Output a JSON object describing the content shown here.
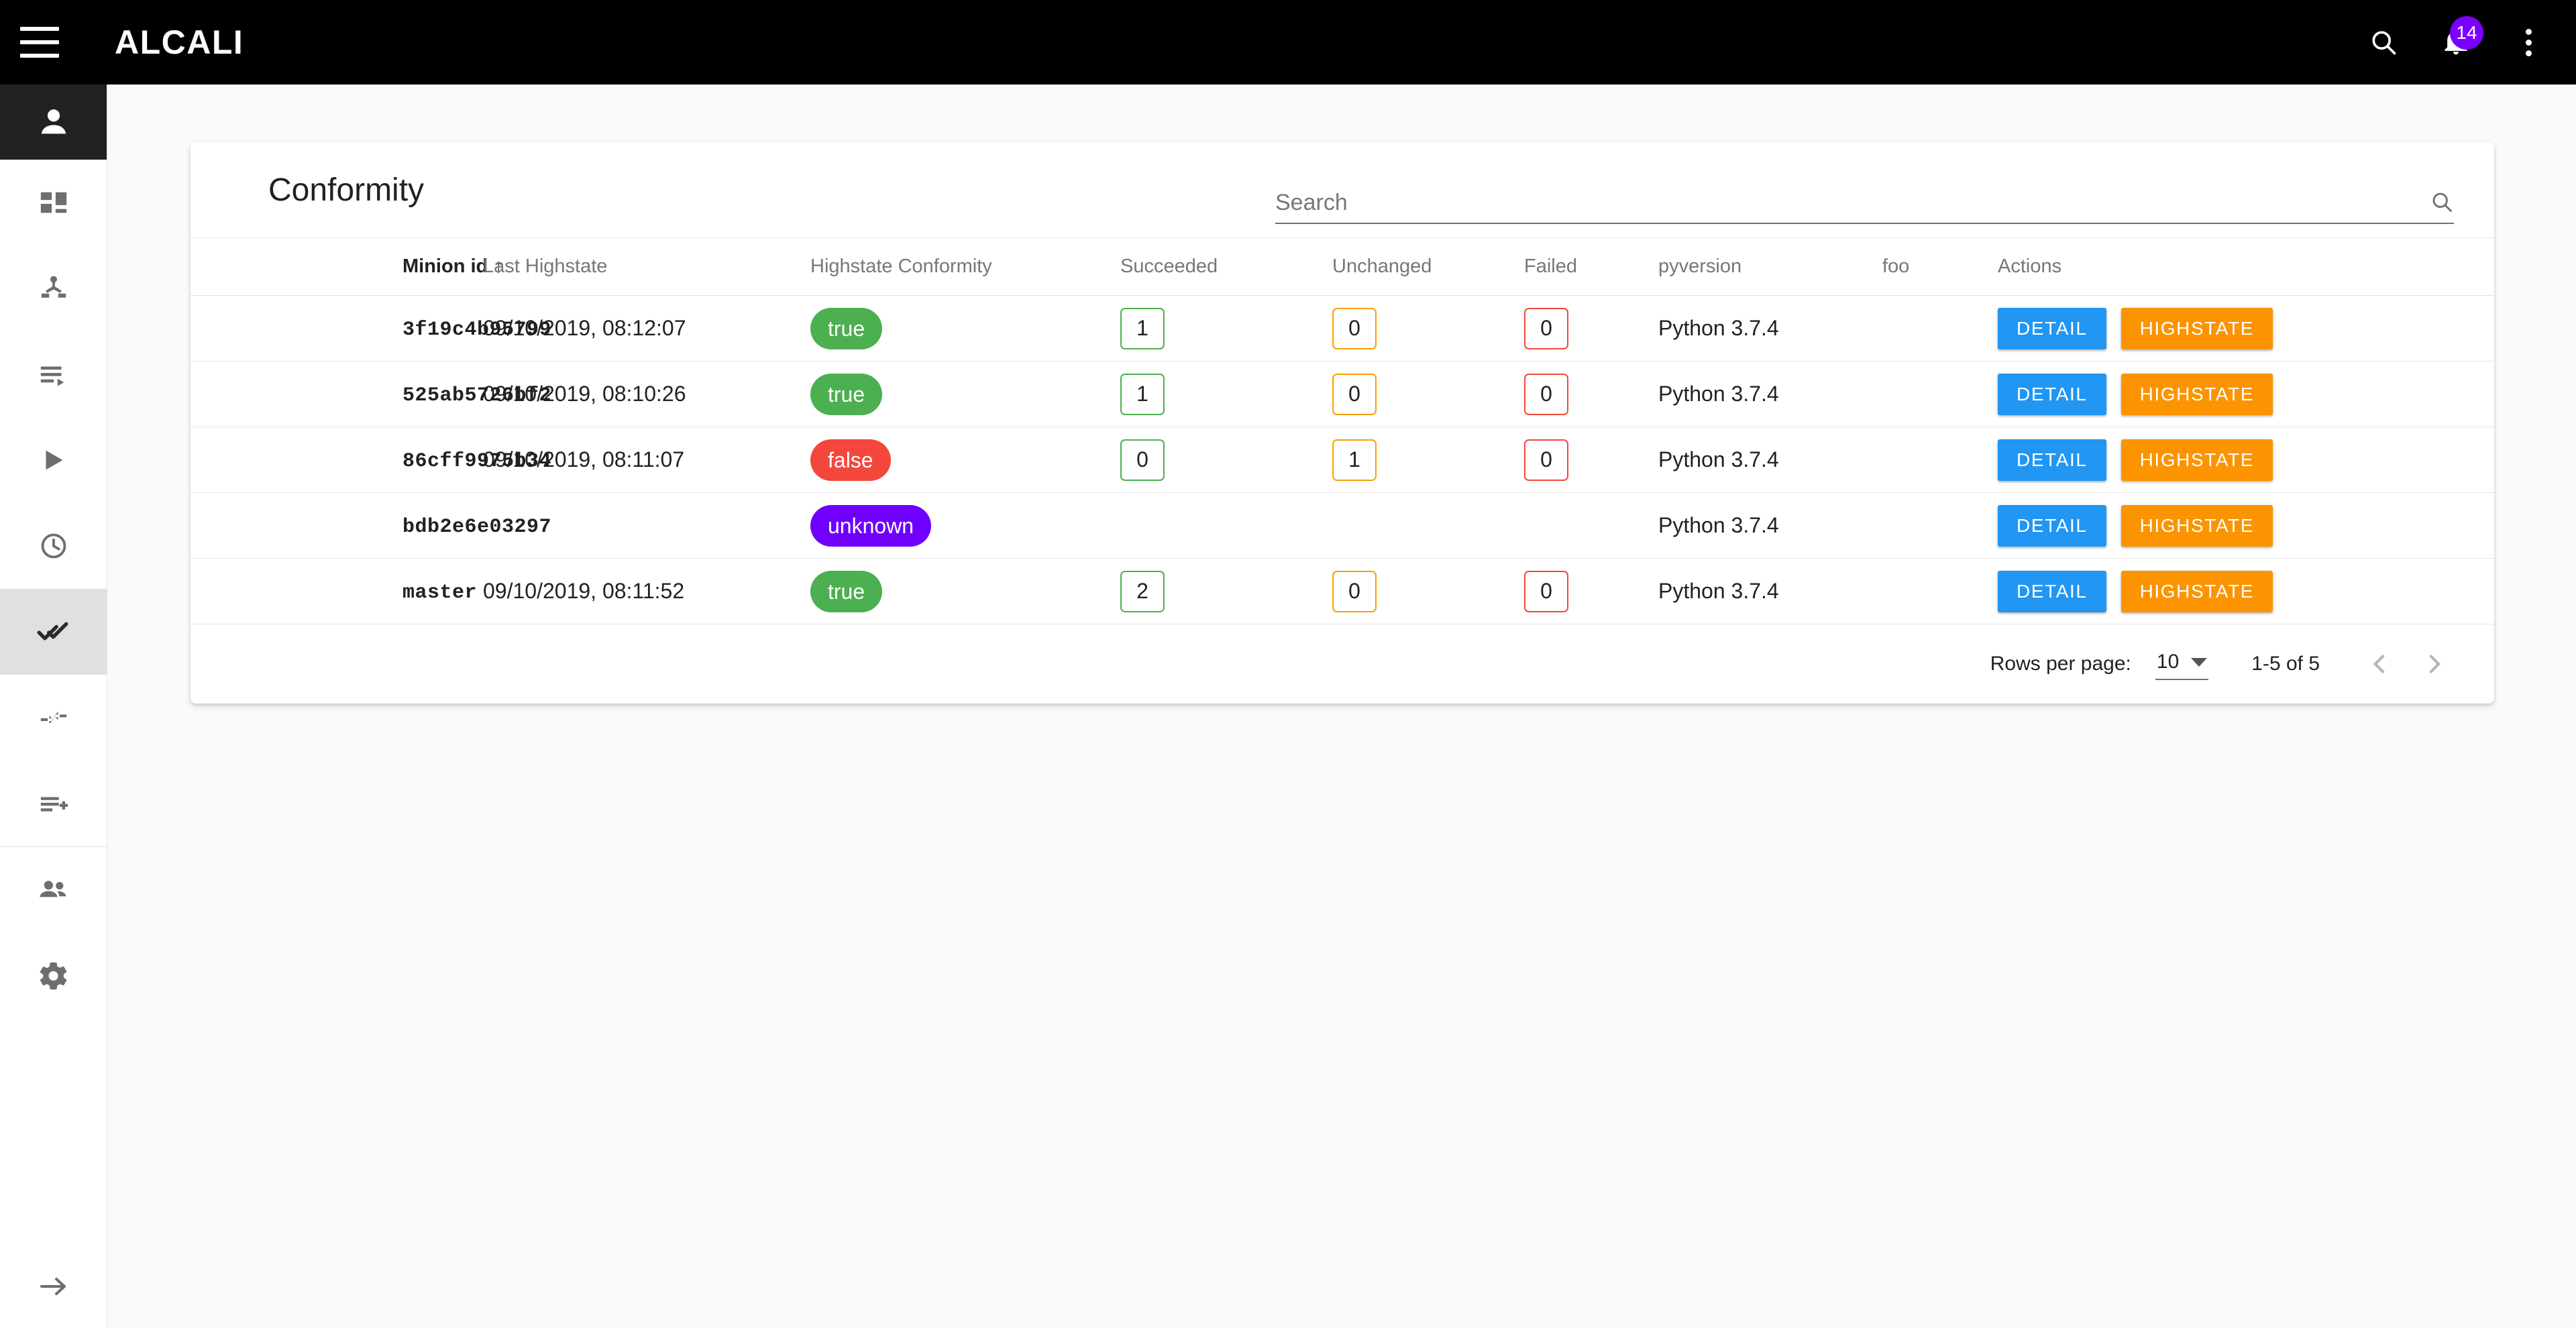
{
  "appbar": {
    "menu_icon": "hamburger-menu-icon",
    "title": "ALCALI",
    "search_icon": "search-icon",
    "notifications_icon": "bell-icon",
    "notifications_count": "14",
    "overflow_icon": "more-vertical-icon"
  },
  "sidebar": {
    "avatar_icon": "person-icon",
    "items": [
      {
        "name": "dashboard",
        "icon": "dashboard-grid-icon",
        "active": false
      },
      {
        "name": "minions",
        "icon": "hierarchy-network-icon",
        "active": false
      },
      {
        "name": "jobs",
        "icon": "queue-list-icon",
        "active": false
      },
      {
        "name": "run",
        "icon": "play-arrow-icon",
        "active": false
      },
      {
        "name": "schedule",
        "icon": "clock-history-icon",
        "active": false
      },
      {
        "name": "conformity",
        "icon": "double-check-icon",
        "active": true
      },
      {
        "name": "sync",
        "icon": "compare-arrows-icon",
        "active": false
      },
      {
        "name": "add-job",
        "icon": "playlist-add-icon",
        "active": false
      },
      {
        "name": "users",
        "icon": "people-group-icon",
        "active": false
      },
      {
        "name": "settings",
        "icon": "gear-icon",
        "active": false
      }
    ],
    "collapse_icon": "arrow-forward-icon"
  },
  "page": {
    "title": "Conformity"
  },
  "search": {
    "placeholder": "Search",
    "value": "",
    "icon": "search-icon"
  },
  "table": {
    "columns": [
      {
        "label": "Minion id",
        "sorted": true,
        "sort_arrow": "↑"
      },
      {
        "label": "Last Highstate",
        "sorted": false,
        "sort_arrow": ""
      },
      {
        "label": "Highstate Conformity",
        "sorted": false,
        "sort_arrow": ""
      },
      {
        "label": "Succeeded",
        "sorted": false,
        "sort_arrow": ""
      },
      {
        "label": "Unchanged",
        "sorted": false,
        "sort_arrow": ""
      },
      {
        "label": "Failed",
        "sorted": false,
        "sort_arrow": ""
      },
      {
        "label": "pyversion",
        "sorted": false,
        "sort_arrow": ""
      },
      {
        "label": "foo",
        "sorted": false,
        "sort_arrow": ""
      },
      {
        "label": "Actions",
        "sorted": false,
        "sort_arrow": ""
      }
    ],
    "rows": [
      {
        "minion_id": "3f19c4b95799",
        "last_highstate": "09/10/2019, 08:12:07",
        "conformity": "true",
        "conformity_color": "green",
        "succeeded": "1",
        "unchanged": "0",
        "failed": "0",
        "pyversion": "Python 3.7.4",
        "foo": ""
      },
      {
        "minion_id": "525ab5726bf2",
        "last_highstate": "09/10/2019, 08:10:26",
        "conformity": "true",
        "conformity_color": "green",
        "succeeded": "1",
        "unchanged": "0",
        "failed": "0",
        "pyversion": "Python 3.7.4",
        "foo": ""
      },
      {
        "minion_id": "86cff9975b34",
        "last_highstate": "09/10/2019, 08:11:07",
        "conformity": "false",
        "conformity_color": "red",
        "succeeded": "0",
        "unchanged": "1",
        "failed": "0",
        "pyversion": "Python 3.7.4",
        "foo": ""
      },
      {
        "minion_id": "bdb2e6e03297",
        "last_highstate": "",
        "conformity": "unknown",
        "conformity_color": "purple",
        "succeeded": "",
        "unchanged": "",
        "failed": "",
        "pyversion": "Python 3.7.4",
        "foo": ""
      },
      {
        "minion_id": "master",
        "last_highstate": "09/10/2019, 08:11:52",
        "conformity": "true",
        "conformity_color": "green",
        "succeeded": "2",
        "unchanged": "0",
        "failed": "0",
        "pyversion": "Python 3.7.4",
        "foo": ""
      }
    ],
    "actions": {
      "detail_label": "DETAIL",
      "highstate_label": "HIGHSTATE"
    }
  },
  "pagination": {
    "rows_per_page_label": "Rows per page:",
    "rows_per_page_value": "10",
    "range_label": "1-5 of 5",
    "prev_icon": "chevron-left-icon",
    "next_icon": "chevron-right-icon"
  },
  "colors": {
    "appbar_bg": "#000000",
    "accent_purple": "#7b00ff",
    "chip_green": "#4caf50",
    "chip_red": "#f4473b",
    "chip_purple": "#6f00ff",
    "button_blue": "#2196f3",
    "button_orange": "#fb9400",
    "box_orange": "#fb9e00",
    "page_bg": "#fafafa"
  }
}
